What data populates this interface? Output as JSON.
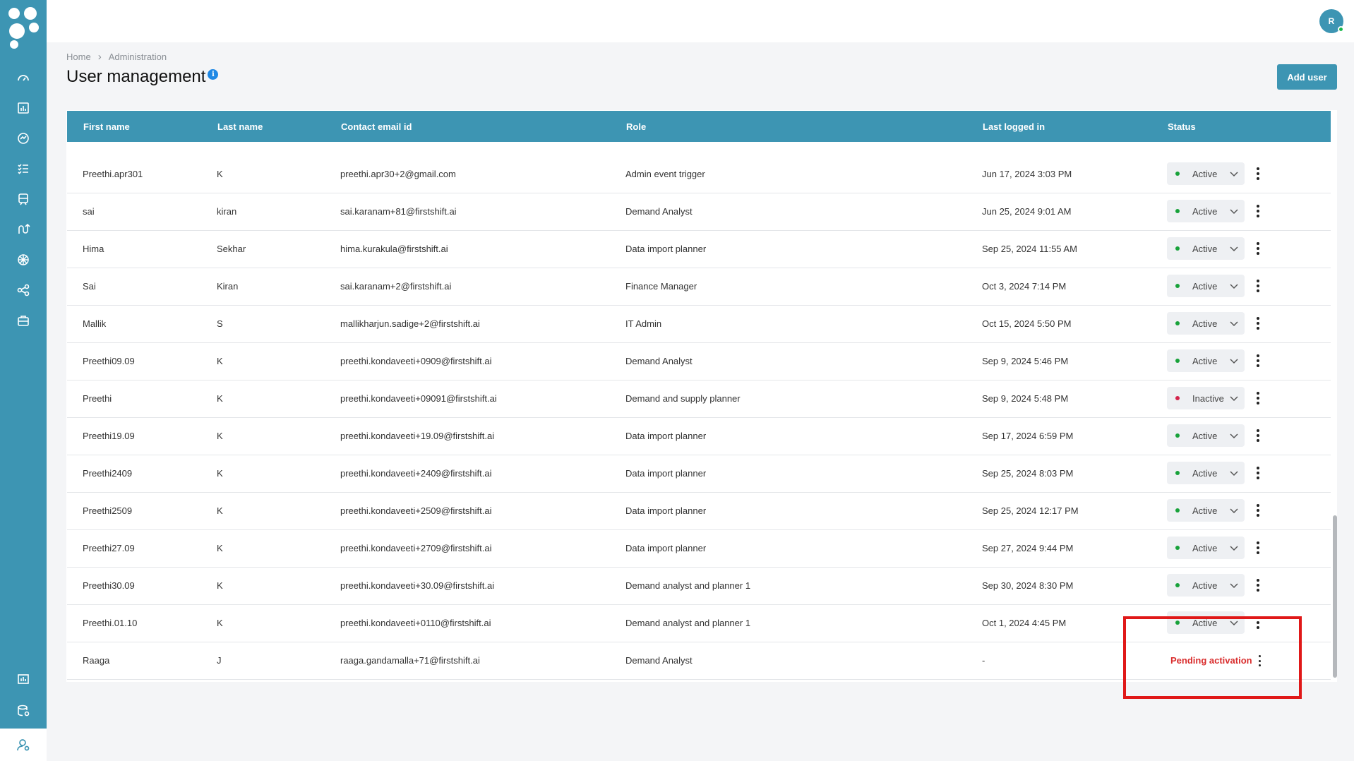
{
  "sidebar": {
    "nav": [
      "dashboard-icon",
      "analytics-icon",
      "monitor-icon",
      "tasks-icon",
      "inventory-icon",
      "flow-icon",
      "ai-icon",
      "network-icon",
      "toolbox-icon",
      "reports-icon",
      "data-settings-icon",
      "user-management-icon"
    ],
    "active": "user-management-icon"
  },
  "user": {
    "avatar_initial": "R"
  },
  "breadcrumb": {
    "home": "Home",
    "current": "Administration"
  },
  "page": {
    "title": "User management",
    "info_glyph": "i",
    "add_user_label": "Add user"
  },
  "table": {
    "headers": {
      "first_name": "First name",
      "last_name": "Last name",
      "email": "Contact email id",
      "role": "Role",
      "last_logged_in": "Last logged in",
      "status": "Status"
    },
    "rows": [
      {
        "first": "Preethi.apr301",
        "last": "K",
        "email": "preethi.apr30+2@gmail.com",
        "role": "Admin event trigger",
        "last_logged": "Jun 17, 2024 3:03 PM",
        "status": "Active"
      },
      {
        "first": "sai",
        "last": "kiran",
        "email": "sai.karanam+81@firstshift.ai",
        "role": "Demand Analyst",
        "last_logged": "Jun 25, 2024 9:01 AM",
        "status": "Active"
      },
      {
        "first": "Hima",
        "last": "Sekhar",
        "email": "hima.kurakula@firstshift.ai",
        "role": "Data import planner",
        "last_logged": "Sep 25, 2024 11:55 AM",
        "status": "Active"
      },
      {
        "first": "Sai",
        "last": "Kiran",
        "email": "sai.karanam+2@firstshift.ai",
        "role": "Finance Manager",
        "last_logged": "Oct 3, 2024 7:14 PM",
        "status": "Active"
      },
      {
        "first": "Mallik",
        "last": "S",
        "email": "mallikharjun.sadige+2@firstshift.ai",
        "role": "IT Admin",
        "last_logged": "Oct 15, 2024 5:50 PM",
        "status": "Active"
      },
      {
        "first": "Preethi09.09",
        "last": "K",
        "email": "preethi.kondaveeti+0909@firstshift.ai",
        "role": "Demand Analyst",
        "last_logged": "Sep 9, 2024 5:46 PM",
        "status": "Active"
      },
      {
        "first": "Preethi",
        "last": "K",
        "email": "preethi.kondaveeti+09091@firstshift.ai",
        "role": "Demand and supply planner",
        "last_logged": "Sep 9, 2024 5:48 PM",
        "status": "Inactive"
      },
      {
        "first": "Preethi19.09",
        "last": "K",
        "email": "preethi.kondaveeti+19.09@firstshift.ai",
        "role": "Data import planner",
        "last_logged": "Sep 17, 2024 6:59 PM",
        "status": "Active"
      },
      {
        "first": "Preethi2409",
        "last": "K",
        "email": "preethi.kondaveeti+2409@firstshift.ai",
        "role": "Data import planner",
        "last_logged": "Sep 25, 2024 8:03 PM",
        "status": "Active"
      },
      {
        "first": "Preethi2509",
        "last": "K",
        "email": "preethi.kondaveeti+2509@firstshift.ai",
        "role": "Data import planner",
        "last_logged": "Sep 25, 2024 12:17 PM",
        "status": "Active"
      },
      {
        "first": "Preethi27.09",
        "last": "K",
        "email": "preethi.kondaveeti+2709@firstshift.ai",
        "role": "Data import planner",
        "last_logged": "Sep 27, 2024 9:44 PM",
        "status": "Active"
      },
      {
        "first": "Preethi30.09",
        "last": "K",
        "email": "preethi.kondaveeti+30.09@firstshift.ai",
        "role": "Demand analyst and planner 1",
        "last_logged": "Sep 30, 2024 8:30 PM",
        "status": "Active"
      },
      {
        "first": "Preethi.01.10",
        "last": "K",
        "email": "preethi.kondaveeti+0110@firstshift.ai",
        "role": "Demand analyst and planner 1",
        "last_logged": "Oct 1, 2024 4:45 PM",
        "status": "Active"
      },
      {
        "first": "Raaga",
        "last": "J",
        "email": "raaga.gandamalla+71@firstshift.ai",
        "role": "Demand Analyst",
        "last_logged": "-",
        "status": "Pending activation"
      }
    ]
  },
  "colors": {
    "brand": "#3d95b3",
    "active_dot": "#18a23a",
    "inactive_dot": "#d3244b",
    "pending": "#d92d2d",
    "highlight": "#e01818"
  }
}
